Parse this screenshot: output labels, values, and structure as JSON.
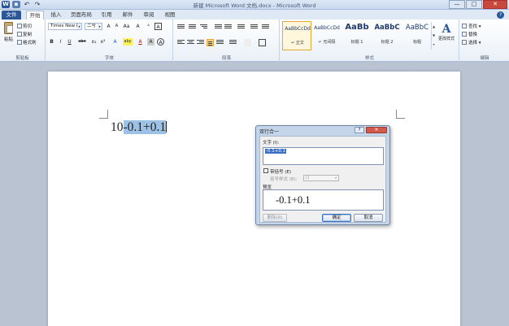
{
  "window": {
    "title": "新建 Microsoft Word 文档.docx - Microsoft Word",
    "minimize": "—",
    "maximize": "□",
    "close": "✕"
  },
  "tabs": [
    {
      "label": "文件"
    },
    {
      "label": "开始"
    },
    {
      "label": "插入"
    },
    {
      "label": "页面布局"
    },
    {
      "label": "引用"
    },
    {
      "label": "邮件"
    },
    {
      "label": "审阅"
    },
    {
      "label": "视图"
    }
  ],
  "help": "?",
  "ribbon": {
    "clipboard": {
      "paste": "粘贴",
      "cut": "剪切",
      "copy": "复制",
      "format_painter": "格式刷",
      "group_label": "剪贴板"
    },
    "font": {
      "font_name": "Times New R",
      "font_size": "二号",
      "group_label": "字体",
      "buttons": [
        "B",
        "I",
        "U",
        "abe",
        "x₂",
        "x²",
        "A",
        "aby",
        "A",
        "Aa",
        "A",
        "A",
        "ᴬ",
        "A"
      ]
    },
    "paragraph": {
      "group_label": "段落"
    },
    "styles": {
      "items": [
        {
          "sample": "AaBbCcDd",
          "name": "↵ 正文"
        },
        {
          "sample": "AaBbCcDd",
          "name": "↵ 无间隔"
        },
        {
          "sample": "AaBb",
          "name": "标题 1"
        },
        {
          "sample": "AaBbC",
          "name": "标题 2"
        },
        {
          "sample": "AaBbC",
          "name": "标题"
        }
      ],
      "change_styles": "更改样式",
      "group_label": "样式"
    },
    "editing": {
      "find": "查找 ▾",
      "replace": "替换",
      "select": "选择 ▾",
      "group_label": "编辑"
    }
  },
  "document": {
    "text_plain": "10",
    "text_selected": "-0.1+0.1"
  },
  "dialog": {
    "title": "双行合一",
    "help": "?",
    "close": "✕",
    "text_label": "文字 (I):",
    "text_value": "-0.1+0.1",
    "bracket_checkbox": "带括号 (E)",
    "bracket_style_label": "括号样式 (B):",
    "bracket_style_value": "()",
    "preview_label": "预览",
    "preview_text": "-0.1+0.1",
    "remove_button": "删除(R)",
    "ok_button": "确定",
    "cancel_button": "取消"
  }
}
